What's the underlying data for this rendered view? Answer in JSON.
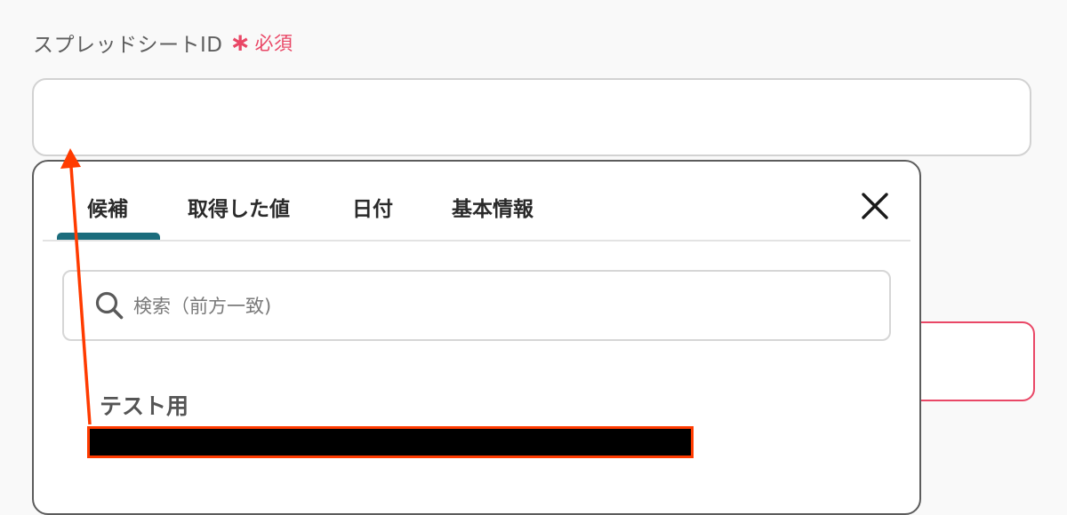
{
  "field": {
    "label": "スプレッドシートID",
    "required_mark": "∗",
    "required_text": "必須"
  },
  "picker": {
    "tabs": [
      {
        "label": "候補",
        "active": true
      },
      {
        "label": "取得した値",
        "active": false
      },
      {
        "label": "日付",
        "active": false
      },
      {
        "label": "基本情報",
        "active": false
      }
    ],
    "search_placeholder": "検索（前方一致)",
    "group_heading": "テスト用"
  },
  "colors": {
    "accent": "#1b6c7c",
    "required": "#e94766",
    "annotation": "#ff3b00"
  },
  "icons": {
    "close": "close-icon",
    "search": "search-icon"
  }
}
